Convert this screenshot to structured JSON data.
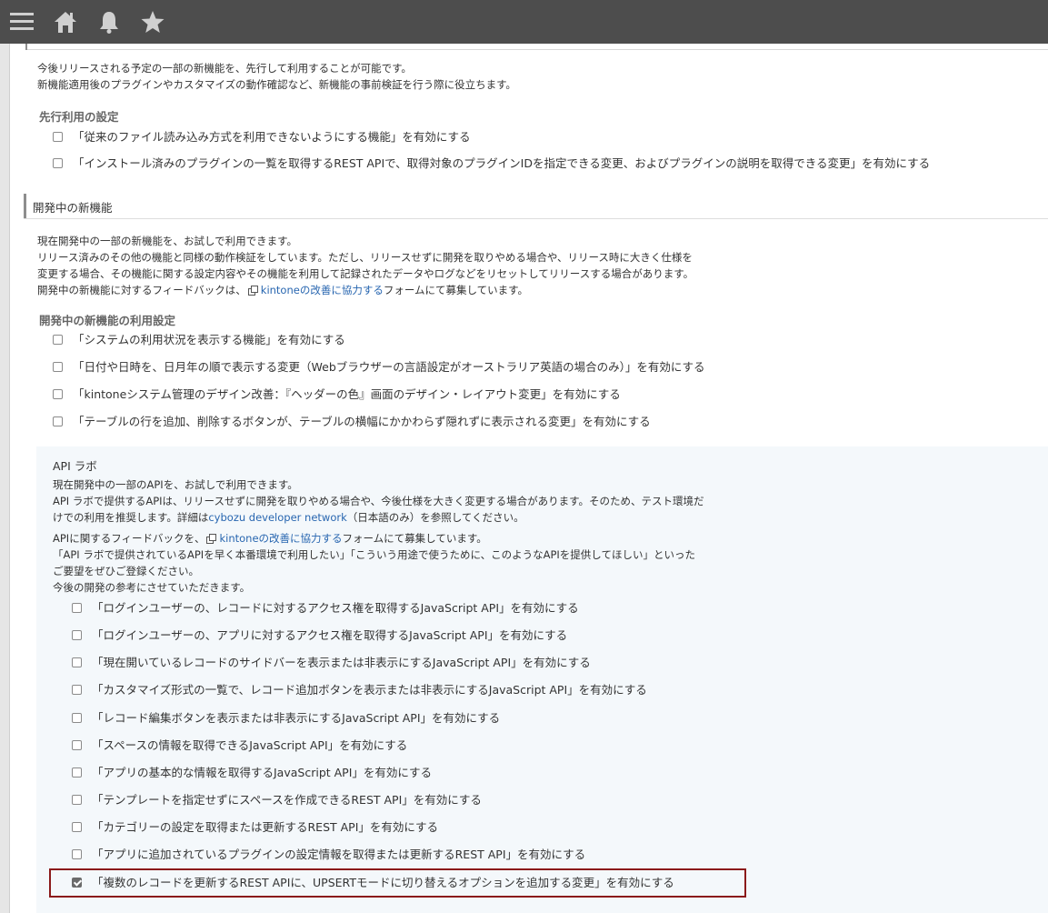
{
  "header": {
    "icons": [
      "menu-icon",
      "home-icon",
      "bell-icon",
      "star-icon"
    ]
  },
  "preview": {
    "desc1": "今後リリースされる予定の一部の新機能を、先行して利用することが可能です。",
    "desc2": "新機能適用後のプラグインやカスタマイズの動作確認など、新機能の事前検証を行う際に役立ちます。",
    "settings_title": "先行利用の設定",
    "items": [
      "「従来のファイル読み込み方式を利用できないようにする機能」を有効にする",
      "「インストール済みのプラグインの一覧を取得するREST APIで、取得対象のプラグインIDを指定できる変更、およびプラグインの説明を取得できる変更」を有効にする"
    ]
  },
  "dev": {
    "title": "開発中の新機能",
    "desc1": "現在開発中の一部の新機能を、お試しで利用できます。",
    "desc2": "リリース済みのその他の機能と同様の動作検証をしています。ただし、リリースせずに開発を取りやめる場合や、リリース時に大きく仕様を",
    "desc3": "変更する場合、その機能に関する設定内容やその機能を利用して記録されたデータやログなどをリセットしてリリースする場合があります。",
    "desc4_pre": "開発中の新機能に対するフィードバックは、",
    "desc4_link": "kintoneの改善に協力する",
    "desc4_post": "フォームにて募集しています。",
    "settings_title": "開発中の新機能の利用設定",
    "items": [
      "「システムの利用状況を表示する機能」を有効にする",
      "「日付や日時を、日月年の順で表示する変更（Webブラウザーの言語設定がオーストラリア英語の場合のみ）」を有効にする",
      "「kintoneシステム管理のデザイン改善：『ヘッダーの色』画面のデザイン・レイアウト変更」を有効にする",
      "「テーブルの行を追加、削除するボタンが、テーブルの横幅にかかわらず隠れずに表示される変更」を有効にする"
    ]
  },
  "api": {
    "title": "API ラボ",
    "desc1": "現在開発中の一部のAPIを、お試しで利用できます。",
    "desc2": "API ラボで提供するAPIは、リリースせずに開発を取りやめる場合や、今後仕様を大きく変更する場合があります。そのため、テスト環境だ",
    "desc3_pre": "けでの利用を推奨します。詳細は",
    "desc3_link": "cybozu developer network",
    "desc3_post": "（日本語のみ）を参照してください。",
    "desc4_pre": "APIに関するフィードバックを、",
    "desc4_link": "kintoneの改善に協力する",
    "desc4_post": "フォームにて募集しています。",
    "desc5": "「API ラボで提供されているAPIを早く本番環境で利用したい」「こういう用途で使うために、このようなAPIを提供してほしい」といった",
    "desc6": "ご要望をぜひご登録ください。",
    "desc7": "今後の開発の参考にさせていただきます。",
    "items": [
      {
        "label": "「ログインユーザーの、レコードに対するアクセス権を取得するJavaScript API」を有効にする",
        "checked": false
      },
      {
        "label": "「ログインユーザーの、アプリに対するアクセス権を取得するJavaScript API」を有効にする",
        "checked": false
      },
      {
        "label": "「現在開いているレコードのサイドバーを表示または非表示にするJavaScript API」を有効にする",
        "checked": false
      },
      {
        "label": "「カスタマイズ形式の一覧で、レコード追加ボタンを表示または非表示にするJavaScript API」を有効にする",
        "checked": false
      },
      {
        "label": "「レコード編集ボタンを表示または非表示にするJavaScript API」を有効にする",
        "checked": false
      },
      {
        "label": "「スペースの情報を取得できるJavaScript API」を有効にする",
        "checked": false
      },
      {
        "label": "「アプリの基本的な情報を取得するJavaScript API」を有効にする",
        "checked": false
      },
      {
        "label": "「テンプレートを指定せずにスペースを作成できるREST API」を有効にする",
        "checked": false
      },
      {
        "label": "「カテゴリーの設定を取得または更新するREST API」を有効にする",
        "checked": false
      },
      {
        "label": "「アプリに追加されているプラグインの設定情報を取得または更新するREST API」を有効にする",
        "checked": false
      },
      {
        "label": "「複数のレコードを更新するREST APIに、UPSERTモードに切り替えるオプションを追加する変更」を有効にする",
        "checked": true
      }
    ]
  },
  "colors": {
    "header_bg": "#4d4d4d",
    "icon": "#d0d0d0",
    "link": "#2866b0",
    "highlight": "#8b1a1a",
    "api_bg": "#f4f8fb"
  }
}
